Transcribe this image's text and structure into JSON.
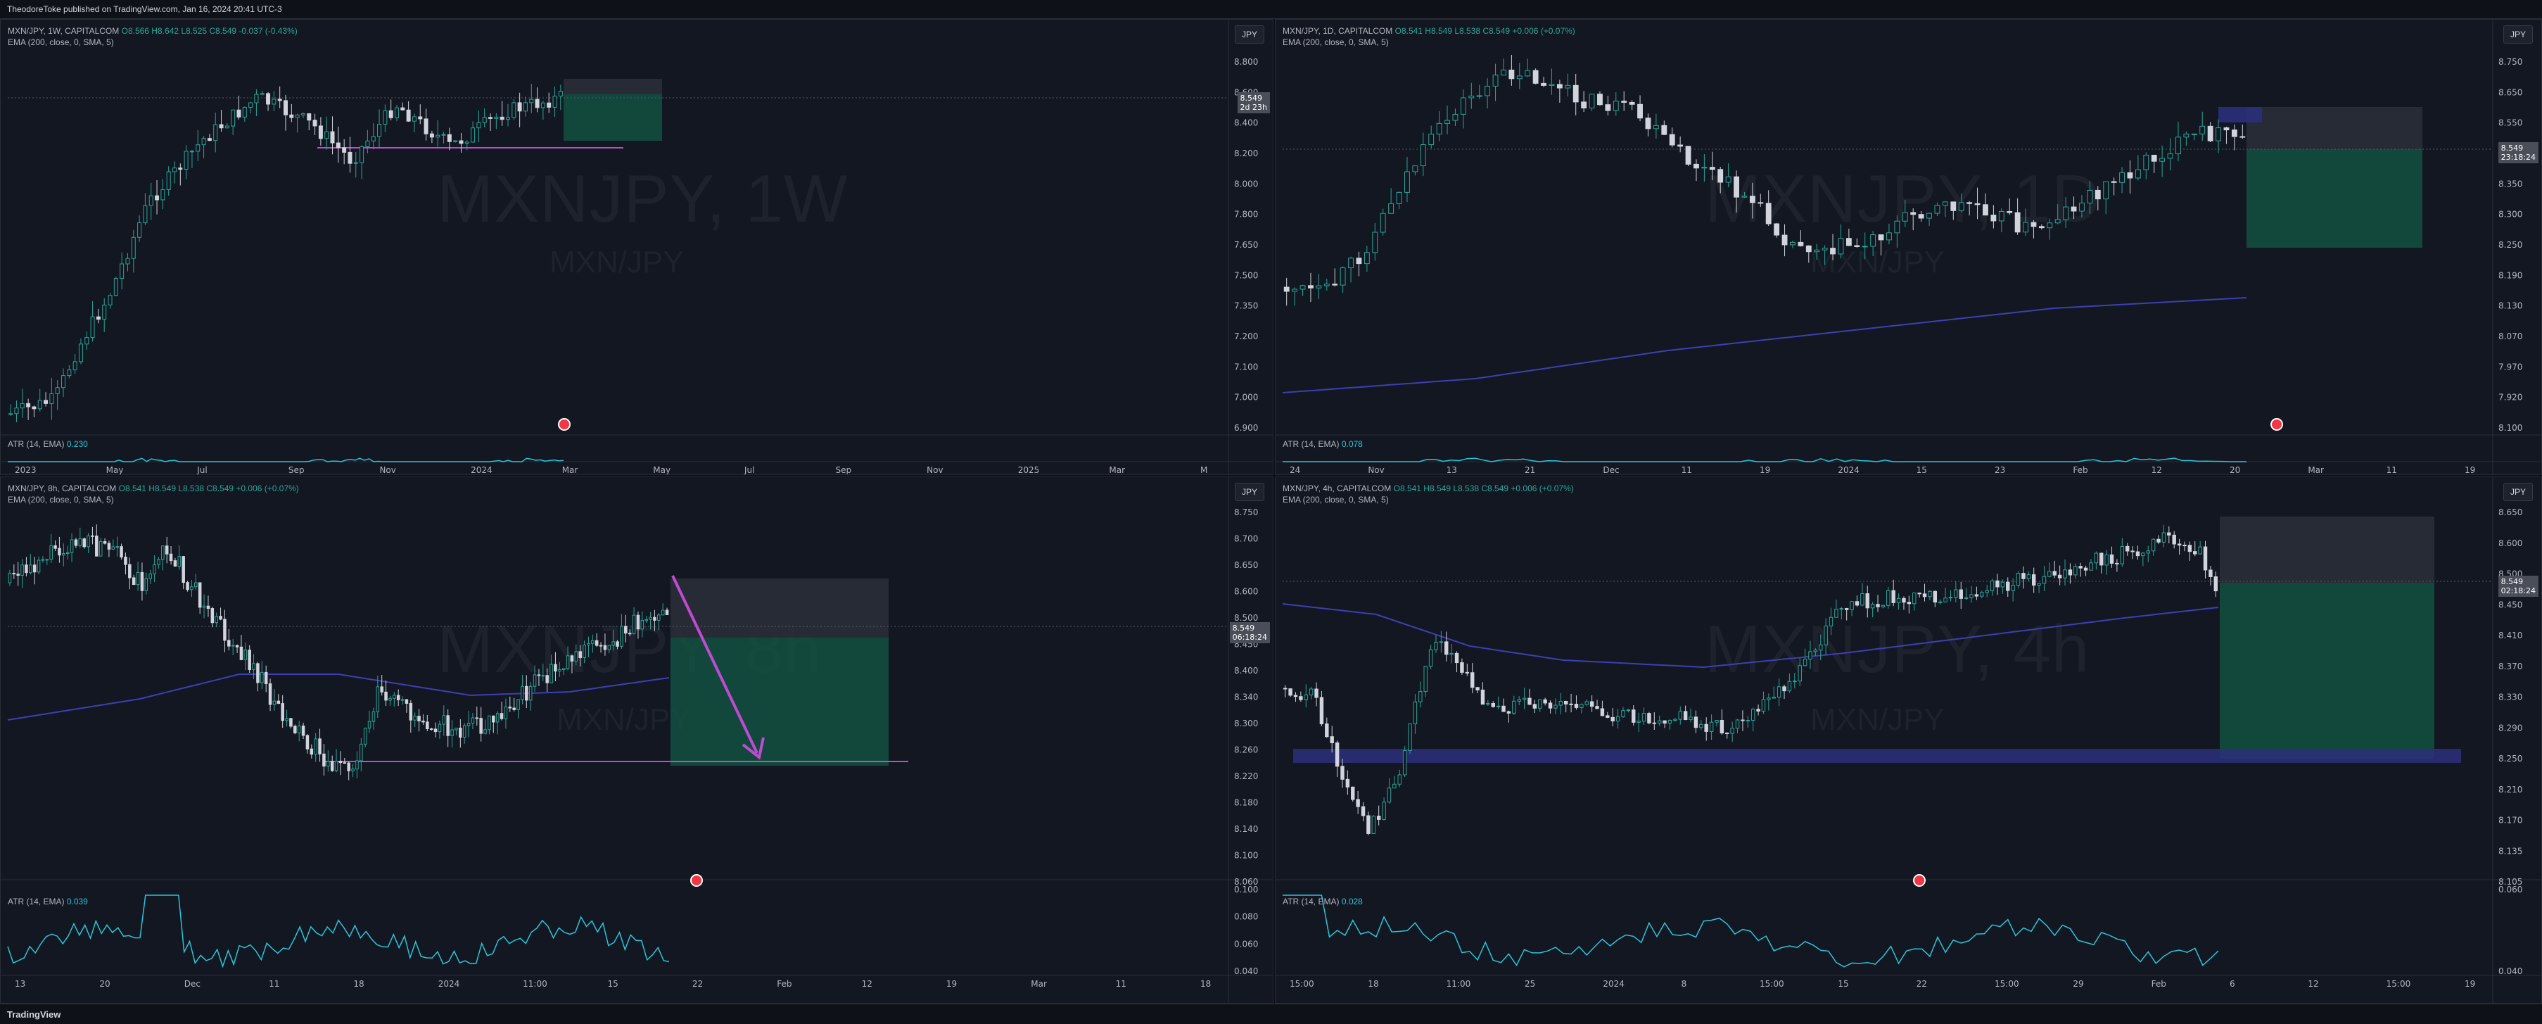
{
  "publish": {
    "text": "TheodoreToke published on TradingView.com, Jan 16, 2024 20:41 UTC-3"
  },
  "footer": {
    "logo": "TradingView"
  },
  "colors": {
    "bg": "#131722",
    "up": "#26a69a",
    "down": "#ef5350",
    "ema": "#3f3fb0",
    "magenta": "#c04ad4",
    "grid": "#1f2330",
    "target": "#134e3f",
    "stop": "#2a2e39"
  },
  "panels": [
    {
      "id": "w1",
      "symbol": "MXN/JPY, 1W, CAPITALCOM",
      "ohlc": "O8.566 H8.642 L8.525 C8.549 -0.037 (-0.43%)",
      "ema": "EMA (200, close, 0, SMA, 5)",
      "watermark": "MXNJPY, 1W",
      "watermark_sub": "MXN/JPY",
      "currency": "JPY",
      "price_tag": "8.549",
      "price_tag_sub": "2d 23h",
      "atr_label": "ATR (14, EMA)",
      "atr_value": "0.230",
      "y_ticks": [
        "8.800",
        "8.600",
        "8.400",
        "8.200",
        "8.000",
        "7.800",
        "7.650",
        "7.500",
        "7.350",
        "7.200",
        "7.100",
        "7.000",
        "6.900"
      ],
      "x_ticks": [
        "2023",
        "May",
        "Jul",
        "Sep",
        "Nov",
        "2024",
        "Mar",
        "May",
        "Jul",
        "Sep",
        "Nov",
        "2025",
        "Mar",
        "M"
      ]
    },
    {
      "id": "d1",
      "symbol": "MXN/JPY, 1D, CAPITALCOM",
      "ohlc": "O8.541 H8.549 L8.538 C8.549 +0.006 (+0.07%)",
      "ema": "EMA (200, close, 0, SMA, 5)",
      "watermark": "MXNJPY, 1D",
      "watermark_sub": "MXN/JPY",
      "currency": "JPY",
      "price_tag": "8.549",
      "price_tag_sub": "23:18:24",
      "atr_label": "ATR (14, EMA)",
      "atr_value": "0.078",
      "y_ticks": [
        "8.750",
        "8.650",
        "8.550",
        "8.450",
        "8.350",
        "8.300",
        "8.250",
        "8.190",
        "8.130",
        "8.070",
        "7.970",
        "7.920",
        "8.100"
      ],
      "x_ticks": [
        "24",
        "Nov",
        "13",
        "21",
        "Dec",
        "11",
        "19",
        "2024",
        "15",
        "23",
        "Feb",
        "12",
        "20",
        "Mar",
        "11",
        "19"
      ]
    },
    {
      "id": "h8",
      "symbol": "MXN/JPY, 8h, CAPITALCOM",
      "ohlc": "O8.541 H8.549 L8.538 C8.549 +0.006 (+0.07%)",
      "ema": "EMA (200, close, 0, SMA, 5)",
      "watermark": "MXNJPY, 8h",
      "watermark_sub": "MXN/JPY",
      "currency": "JPY",
      "price_tag": "8.549",
      "price_tag_sub": "06:18:24",
      "atr_label": "ATR (14, EMA)",
      "atr_value": "0.039",
      "y_ticks": [
        "8.750",
        "8.700",
        "8.650",
        "8.600",
        "8.500",
        "8.450",
        "8.400",
        "8.340",
        "8.300",
        "8.260",
        "8.220",
        "8.180",
        "8.140",
        "8.100",
        "8.060"
      ],
      "atr_ticks": [
        "0.100",
        "0.080",
        "0.060",
        "0.040"
      ],
      "x_ticks": [
        "13",
        "20",
        "Dec",
        "11",
        "18",
        "2024",
        "11:00",
        "15",
        "22",
        "Feb",
        "12",
        "19",
        "Mar",
        "11",
        "18"
      ]
    },
    {
      "id": "h4",
      "symbol": "MXN/JPY, 4h, CAPITALCOM",
      "ohlc": "O8.541 H8.549 L8.538 C8.549 +0.006 (+0.07%)",
      "ema": "EMA (200, close, 0, SMA, 5)",
      "watermark": "MXNJPY, 4h",
      "watermark_sub": "MXN/JPY",
      "currency": "JPY",
      "price_tag": "8.549",
      "price_tag_sub": "02:18:24",
      "atr_label": "ATR (14, EMA)",
      "atr_value": "0.028",
      "y_ticks": [
        "8.650",
        "8.600",
        "8.500",
        "8.450",
        "8.410",
        "8.370",
        "8.330",
        "8.290",
        "8.250",
        "8.210",
        "8.170",
        "8.135",
        "8.105"
      ],
      "atr_ticks": [
        "0.060",
        "0.040"
      ],
      "x_ticks": [
        "15:00",
        "18",
        "11:00",
        "25",
        "2024",
        "8",
        "15:00",
        "15",
        "22",
        "15:00",
        "29",
        "Feb",
        "6",
        "12",
        "15:00",
        "19"
      ]
    }
  ]
}
